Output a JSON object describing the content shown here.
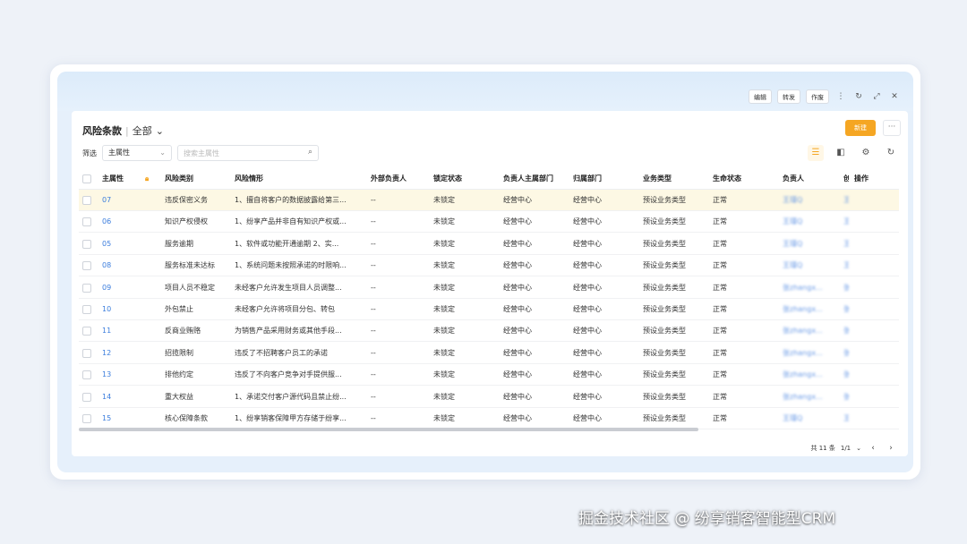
{
  "toolbar": {
    "edit": "编辑",
    "forward": "转发",
    "void": "作废",
    "more_icon": "⋮",
    "refresh_icon": "↻",
    "expand_icon": "⤢",
    "close_icon": "✕"
  },
  "header": {
    "title": "风险条款",
    "view": "全部",
    "new_button": "新建",
    "more_button": "···"
  },
  "filter": {
    "label": "筛选",
    "field": "主属性",
    "placeholder": "搜索主属性"
  },
  "table": {
    "columns": [
      "主属性",
      "风险类别",
      "风险情形",
      "外部负责人",
      "锁定状态",
      "负责人主属部门",
      "归属部门",
      "业务类型",
      "生命状态",
      "负责人",
      "创",
      "操作"
    ],
    "rows": [
      [
        "07",
        "违反保密义务",
        "1、擅自将客户的数据披露给第三...",
        "--",
        "未锁定",
        "经营中心",
        "经营中心",
        "预设业务类型",
        "正常",
        "王瑾Q",
        "王"
      ],
      [
        "06",
        "知识产权侵权",
        "1、纷享产品并非自有知识产权或...",
        "--",
        "未锁定",
        "经营中心",
        "经营中心",
        "预设业务类型",
        "正常",
        "王瑾Q",
        "王"
      ],
      [
        "05",
        "服务逾期",
        "1、软件或功能开通逾期 2、实...",
        "--",
        "未锁定",
        "经营中心",
        "经营中心",
        "预设业务类型",
        "正常",
        "王瑾Q",
        "王"
      ],
      [
        "08",
        "服务标准未达标",
        "1、系统问题未按照承诺的时限响...",
        "--",
        "未锁定",
        "经营中心",
        "经营中心",
        "预设业务类型",
        "正常",
        "王瑾Q",
        "王"
      ],
      [
        "09",
        "项目人员不稳定",
        "未经客户允许发生项目人员调整...",
        "--",
        "未锁定",
        "经营中心",
        "经营中心",
        "预设业务类型",
        "正常",
        "张zhangx...",
        "张"
      ],
      [
        "10",
        "外包禁止",
        "未经客户允许将项目分包、转包",
        "--",
        "未锁定",
        "经营中心",
        "经营中心",
        "预设业务类型",
        "正常",
        "张zhangx...",
        "张"
      ],
      [
        "11",
        "反商业贿赂",
        "为销售产品采用财务或其他手段...",
        "--",
        "未锁定",
        "经营中心",
        "经营中心",
        "预设业务类型",
        "正常",
        "张zhangx...",
        "张"
      ],
      [
        "12",
        "招揽限制",
        "违反了不招聘客户员工的承诺",
        "--",
        "未锁定",
        "经营中心",
        "经营中心",
        "预设业务类型",
        "正常",
        "张zhangx...",
        "张"
      ],
      [
        "13",
        "排他约定",
        "违反了不向客户竞争对手提供服...",
        "--",
        "未锁定",
        "经营中心",
        "经营中心",
        "预设业务类型",
        "正常",
        "张zhangx...",
        "张"
      ],
      [
        "14",
        "重大权益",
        "1、承诺交付客户源代码且禁止纷...",
        "--",
        "未锁定",
        "经营中心",
        "经营中心",
        "预设业务类型",
        "正常",
        "张zhangx...",
        "张"
      ],
      [
        "15",
        "核心保障条款",
        "1、纷享销客保障甲方存储于纷享...",
        "--",
        "未锁定",
        "经营中心",
        "经营中心",
        "预设业务类型",
        "正常",
        "王瑾Q",
        "王"
      ]
    ]
  },
  "pager": {
    "total": "共 11 条",
    "page": "1/1",
    "prev": "‹",
    "next": "›"
  },
  "watermark": "掘金技术社区 @ 纷享销客智能型CRM",
  "colors": {
    "accent": "#f5a623",
    "link": "#3b7ddd",
    "selected_row": "#fdf8e4"
  }
}
